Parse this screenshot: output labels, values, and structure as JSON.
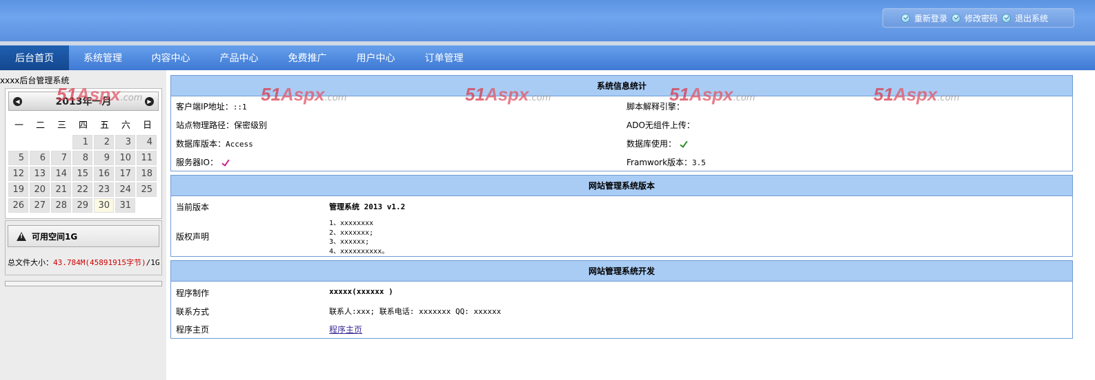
{
  "header": {
    "links": [
      {
        "label": "重新登录",
        "icon": "check-circle-icon"
      },
      {
        "label": "修改密码",
        "icon": "check-circle-icon"
      },
      {
        "label": "退出系统",
        "icon": "check-circle-icon"
      }
    ]
  },
  "nav": {
    "items": [
      {
        "label": "后台首页",
        "active": true
      },
      {
        "label": "系统管理"
      },
      {
        "label": "内容中心"
      },
      {
        "label": "产品中心"
      },
      {
        "label": "免费推广"
      },
      {
        "label": "用户中心"
      },
      {
        "label": "订单管理"
      }
    ]
  },
  "sidebar": {
    "title": "xxxx后台管理系统",
    "calendar": {
      "title": "2013年一月",
      "weekdays": [
        "一",
        "二",
        "三",
        "四",
        "五",
        "六",
        "日"
      ],
      "days": [
        "",
        "",
        "",
        "1",
        "2",
        "3",
        "4",
        "5",
        "6",
        "7",
        "8",
        "9",
        "10",
        "11",
        "12",
        "13",
        "14",
        "15",
        "16",
        "17",
        "18",
        "19",
        "20",
        "21",
        "22",
        "23",
        "24",
        "25",
        "26",
        "27",
        "28",
        "29",
        "30",
        "31",
        ""
      ],
      "today": "30"
    },
    "space": {
      "label": "可用空间1G",
      "filesize_label": "总文件大小：",
      "filesize_value": "43.784M(45891915字节)",
      "filesize_total": "/1G"
    }
  },
  "watermark": {
    "brand": "51",
    "aspx": "Aspx",
    "suffix": ".com"
  },
  "panels": {
    "stats": {
      "title": "系统信息统计",
      "client_ip_label": "客户端IP地址：",
      "client_ip_value": "::1",
      "path_label": "站点物理路径：",
      "path_value": "保密级别",
      "db_version_label": "数据库版本：",
      "db_version_value": "Access",
      "server_io_label": "服务器IO：",
      "script_engine_label": "脚本解释引擎：",
      "ado_label": "ADO无组件上传：",
      "db_use_label": "数据库使用：",
      "framework_label": "Framwork版本：",
      "framework_value": "3.5"
    },
    "version": {
      "title": "网站管理系统版本",
      "current_label": "当前版本",
      "current_value": "管理系统 2013 v1.2",
      "copyright_label": "版权声明",
      "copyright_lines": [
        "1、xxxxxxxx",
        "2、xxxxxxx;",
        "3、xxxxxx;",
        "4、xxxxxxxxxx。"
      ]
    },
    "dev": {
      "title": "网站管理系统开发",
      "maker_label": "程序制作",
      "maker_value": "xxxxx(xxxxxx )",
      "contact_label": "联系方式",
      "contact_value": "联系人:xxx; 联系电话: xxxxxxx QQ: xxxxxx",
      "home_label": "程序主页",
      "home_link": "程序主页"
    }
  }
}
